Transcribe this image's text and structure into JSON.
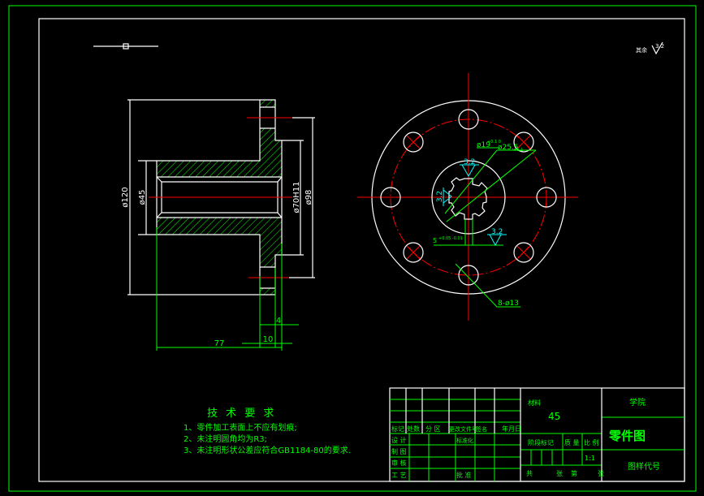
{
  "colors": {
    "outline": "#ffffff",
    "dimension": "#00ff00",
    "centerline": "#ff0000",
    "roughness": "#00ffff",
    "background": "#000000"
  },
  "roughness_note": {
    "label": "其余",
    "value": "3.2"
  },
  "section_view": {
    "dims": {
      "outer_dia": "ø120",
      "bore_dia": "ø45",
      "hub_dia": "ø70H11",
      "pcd_dia": "ø98",
      "length": "77",
      "flange": "10",
      "step": "4"
    }
  },
  "end_view": {
    "spline_dims": {
      "minor": "ø19",
      "minor_tol": "+0.1 0",
      "major": "ø25.5",
      "major_tol": "+0.1",
      "width": "5",
      "width_tol": "+0.05 -0.01",
      "holes": "8-ø13"
    },
    "roughness": [
      "3.2",
      "3.2",
      "3.2"
    ]
  },
  "tech_requirements": {
    "title": "技 术 要 求",
    "items": [
      "1、零件加工表面上不应有划痕;",
      "2、未注明圆角均为R3;",
      "3、未注明形状公差应符合GB1184-80的要求."
    ]
  },
  "title_block": {
    "material_label": "材料",
    "material": "45",
    "school": "学院",
    "drawing_name": "零件图",
    "drawing_code": "图样代号",
    "mark": "标记",
    "count": "处数",
    "zone": "分 区",
    "change_doc": "更改文件号",
    "sign": "签名",
    "date": "年月日",
    "design": "设 计",
    "standardize": "标准化",
    "drafting": "制 图",
    "review": "审 核",
    "process": "工 艺",
    "approve": "批 准",
    "stage_mark": "阶段标记",
    "weight": "质 量",
    "scale_label": "比 例",
    "scale": "1:1",
    "total": "共",
    "sheets": "张",
    "sheet_no": "第",
    "sheet_unit": "张"
  }
}
